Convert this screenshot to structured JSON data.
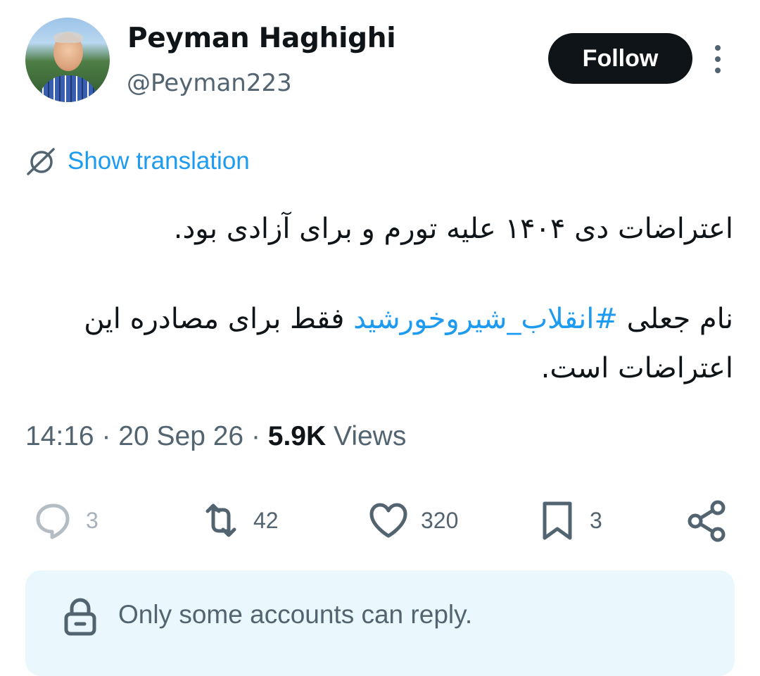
{
  "author": {
    "display_name": "Peyman Haghighi",
    "handle": "@Peyman223"
  },
  "header": {
    "follow_label": "Follow"
  },
  "translation": {
    "label": "Show translation"
  },
  "tweet": {
    "line1": "اعتراضات دی ۱۴۰۴ علیه تورم و برای آزادی بود.",
    "line2_before": "نام جعلی ",
    "hashtag": "#انقلاب_شیروخورشید",
    "line2_after": " فقط برای مصادره این اعتراضات است."
  },
  "meta": {
    "time": "14:16",
    "date": "20 Sep 26",
    "views_count": "5.9K",
    "views_label": "Views"
  },
  "actions": {
    "replies": "3",
    "reposts": "42",
    "likes": "320",
    "bookmarks": "3"
  },
  "reply_restriction": {
    "text": "Only some accounts can reply."
  },
  "colors": {
    "accent": "#1d9bf0",
    "text": "#0f1419",
    "muted": "#536471",
    "banner": "#eaf7fd"
  }
}
